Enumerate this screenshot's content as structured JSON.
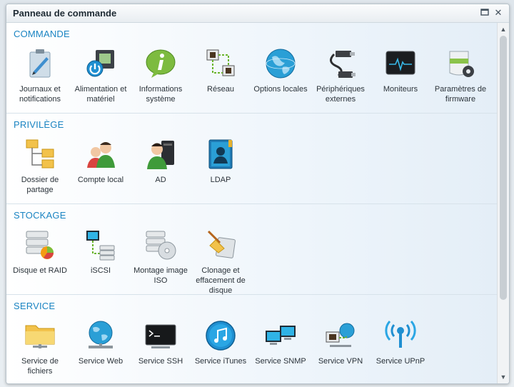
{
  "window": {
    "title": "Panneau de commande"
  },
  "sections": [
    {
      "title": "COMMANDE",
      "items": [
        {
          "label": "Journaux et notifications",
          "icon": "notepad-icon"
        },
        {
          "label": "Alimentation et matériel",
          "icon": "power-hardware-icon"
        },
        {
          "label": "Informations système",
          "icon": "info-icon"
        },
        {
          "label": "Réseau",
          "icon": "network-icon"
        },
        {
          "label": "Options locales",
          "icon": "globe-icon"
        },
        {
          "label": "Périphériques externes",
          "icon": "usb-cable-icon"
        },
        {
          "label": "Moniteurs",
          "icon": "monitor-icon"
        },
        {
          "label": "Paramètres de firmware",
          "icon": "firmware-icon"
        }
      ]
    },
    {
      "title": "PRIVILÈGE",
      "items": [
        {
          "label": "Dossier de partage",
          "icon": "share-folder-icon"
        },
        {
          "label": "Compte local",
          "icon": "local-users-icon"
        },
        {
          "label": "AD",
          "icon": "ad-user-icon"
        },
        {
          "label": "LDAP",
          "icon": "ldap-book-icon"
        }
      ]
    },
    {
      "title": "STOCKAGE",
      "items": [
        {
          "label": "Disque et RAID",
          "icon": "disk-raid-icon"
        },
        {
          "label": "iSCSI",
          "icon": "iscsi-icon"
        },
        {
          "label": "Montage image ISO",
          "icon": "iso-disc-icon"
        },
        {
          "label": "Clonage et effacement de disque",
          "icon": "broom-icon"
        }
      ]
    },
    {
      "title": "SERVICE",
      "items": [
        {
          "label": "Service de fichiers",
          "icon": "file-folder-icon"
        },
        {
          "label": "Service Web",
          "icon": "web-globe-icon"
        },
        {
          "label": "Service SSH",
          "icon": "terminal-icon"
        },
        {
          "label": "Service iTunes",
          "icon": "music-icon"
        },
        {
          "label": "Service SNMP",
          "icon": "snmp-monitors-icon"
        },
        {
          "label": "Service VPN",
          "icon": "vpn-icon"
        },
        {
          "label": "Service UPnP",
          "icon": "upnp-antenna-icon"
        }
      ]
    }
  ],
  "colors": {
    "section_title": "#1a84c2",
    "accent": "#2a9fd6"
  }
}
